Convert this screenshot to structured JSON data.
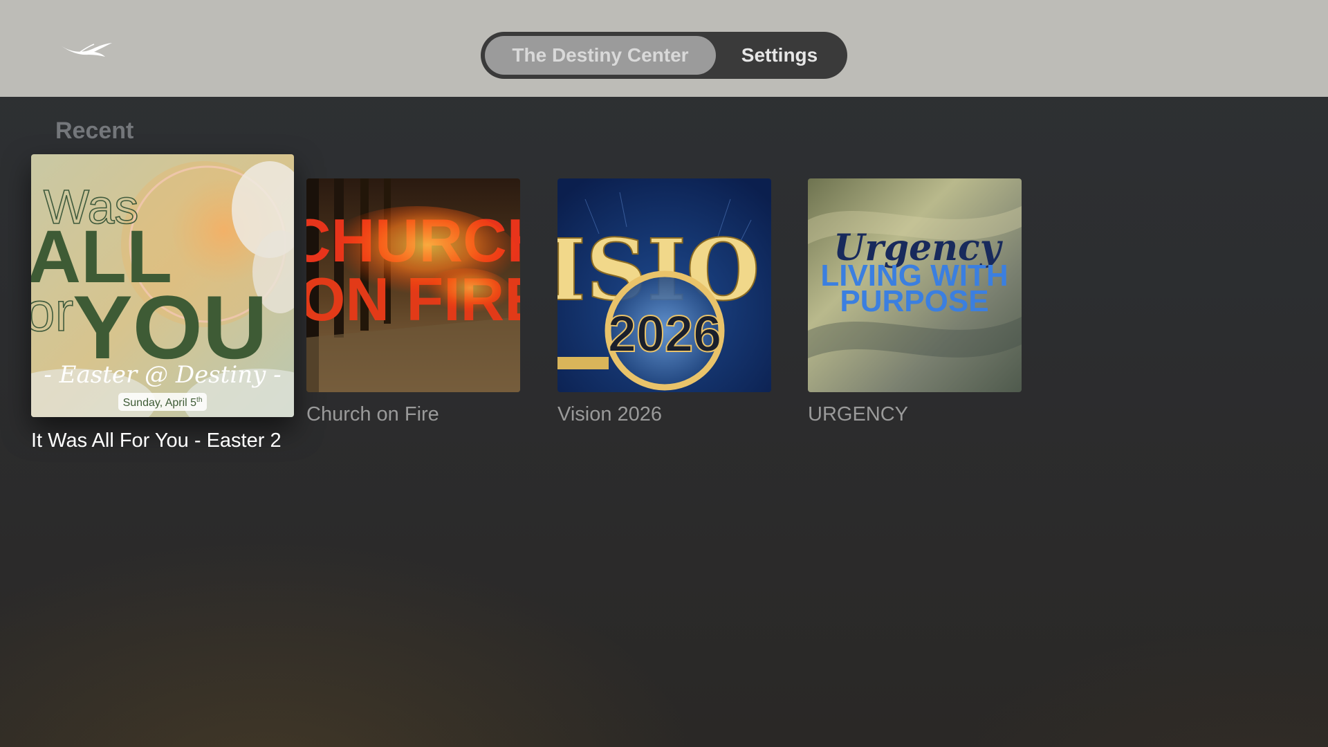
{
  "nav": {
    "tabs": [
      {
        "label": "The Destiny Center",
        "selected": true
      },
      {
        "label": "Settings",
        "selected": false
      }
    ],
    "logo_icon": "dove-icon"
  },
  "recent": {
    "title": "Recent",
    "items": [
      {
        "label": "It Was All For You - Easter 2",
        "focused": true,
        "artwork": {
          "line1": "Was",
          "line2": "ALL",
          "line3": "or",
          "line4": "YOU",
          "subtitle": "- Easter @ Destiny -",
          "date": "Sunday, April 5",
          "date_sup": "th"
        }
      },
      {
        "label": "Church on Fire",
        "focused": false,
        "artwork": {
          "line1": "CHURCH",
          "line2": "ON FIRE"
        }
      },
      {
        "label": "Vision 2026",
        "focused": false,
        "artwork": {
          "line1": "ISIO",
          "line2": "2026"
        }
      },
      {
        "label": "URGENCY",
        "focused": false,
        "artwork": {
          "line1": "Urgency",
          "line2": "LIVING WITH",
          "line3": "PURPOSE"
        }
      }
    ]
  },
  "colors": {
    "topbar": "#bdbcb7",
    "segment_bg": "#3a3a3a",
    "segment_active": "#9b9b9b",
    "background": "#2c2d2f"
  }
}
